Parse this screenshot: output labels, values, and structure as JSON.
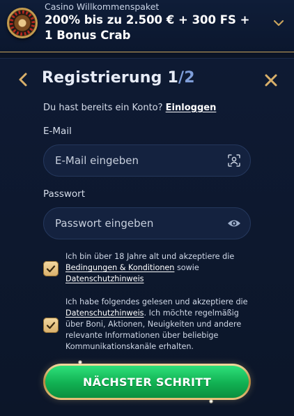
{
  "banner": {
    "kicker": "Casino Willkommenspaket",
    "title": "200% bis zu 2.500 € + 300 FS + 1 Bonus Crab",
    "image_icon": "roulette-wheel-icon",
    "toggle_icon": "chevron-down-icon"
  },
  "form": {
    "title": "Registrierung 1",
    "step_total": "/2",
    "back_icon": "chevron-left-icon",
    "close_icon": "close-icon",
    "login_prompt": "Du hast bereits ein Konto?",
    "login_link": "Einloggen",
    "email": {
      "label": "E-Mail",
      "placeholder": "E-Mail eingeben",
      "value": "",
      "icon": "contact-id-icon"
    },
    "password": {
      "label": "Passwort",
      "placeholder": "Passwort eingeben",
      "value": "",
      "icon": "eye-icon"
    },
    "consents": [
      {
        "checked": true,
        "text_before": "Ich bin über 18 Jahre alt und akzeptiere die",
        "link1": "Bedingungen & Konditionen",
        "text_middle": "sowie",
        "link2": "Datenschutzhinweis"
      },
      {
        "checked": true,
        "text_before": "Ich habe folgendes gelesen und akzeptiere die",
        "link1": "Datenschutzhinweis",
        "text_after": ". Ich möchte regelmäßig über Boni, Aktionen, Neuigkeiten und andere relevante Informationen über beliebige Kommunikationskanäle erhalten."
      }
    ],
    "next_button": "NÄCHSTER SCHRITT"
  },
  "colors": {
    "background": "#0b1426",
    "input_bg": "#14223f",
    "accent_gold": "#d9b06a",
    "step_blue": "#7f9ed9",
    "button_green": "#11b052"
  }
}
